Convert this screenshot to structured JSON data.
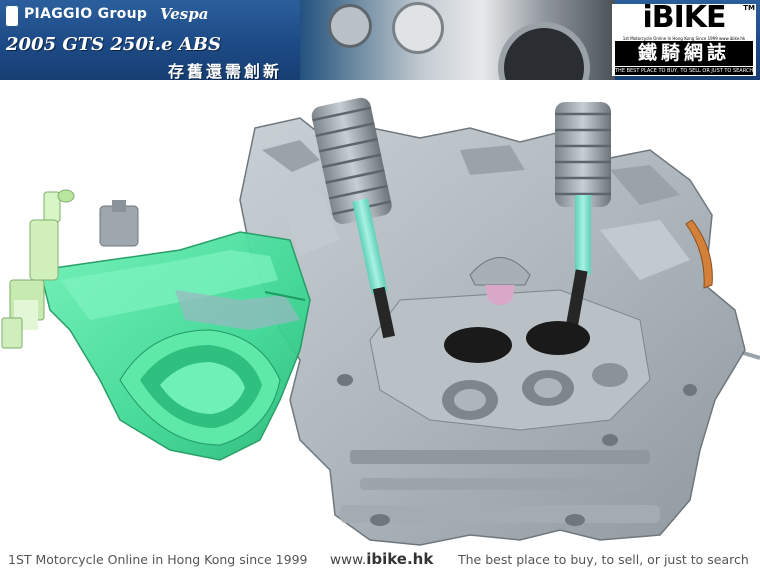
{
  "header": {
    "group_name": "PIAGGIO Group",
    "brand_script": "Vespa",
    "model_title": "2005 GTS 250i.e ABS",
    "slogan": "存舊還需創新"
  },
  "logo": {
    "name": "iBIKE",
    "trademark": "TM",
    "tagline_small": "1st Motorcycle Online In Hong Kong Since 1999  www.ibike.hk",
    "chinese": "鐵騎網誌",
    "tagline": "THE BEST PLACE TO BUY, TO SELL OR JUST TO SEARCH"
  },
  "footer": {
    "left": "1ST Motorcycle Online in Hong Kong since 1999",
    "url_prefix": "www.",
    "url_domain": "ibike",
    "url_suffix": ".hk",
    "right": "The best place to buy, to sell, or just to search"
  },
  "colors": {
    "banner_blue": "#1d4a86",
    "head_grey": "#b4bcc2",
    "intake_green": "#3ee09a",
    "valve_stem_cyan": "#7de3cf",
    "valve_black": "#1a1a1a"
  }
}
